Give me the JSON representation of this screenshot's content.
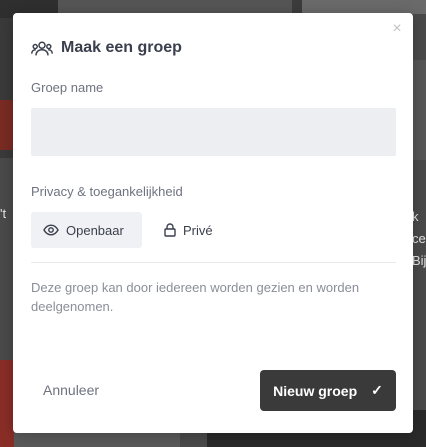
{
  "modal": {
    "title": "Maak een groep",
    "close_symbol": "×",
    "header_icon": "users-icon",
    "fields": {
      "name_label": "Groep name",
      "name_value": "",
      "privacy_label": "Privacy & toegankelijkheid"
    },
    "privacy_options": [
      {
        "label": "Openbaar",
        "icon": "eye-icon",
        "selected": true
      },
      {
        "label": "Privé",
        "icon": "lock-icon",
        "selected": false
      }
    ],
    "description": "Deze groep kan door iedereen worden gezien en worden deelgenomen.",
    "buttons": {
      "cancel": "Annuleer",
      "submit": "Nieuw groep",
      "submit_icon": "check-icon"
    }
  },
  "background": {
    "left_text": "'t",
    "right_text": "k\nce\nBij"
  },
  "colors": {
    "primary_button": "#3a3a3a",
    "input_bg": "#eceef2",
    "selected_option_bg": "#f0f1f4",
    "overlay": "#4a4a4a"
  }
}
